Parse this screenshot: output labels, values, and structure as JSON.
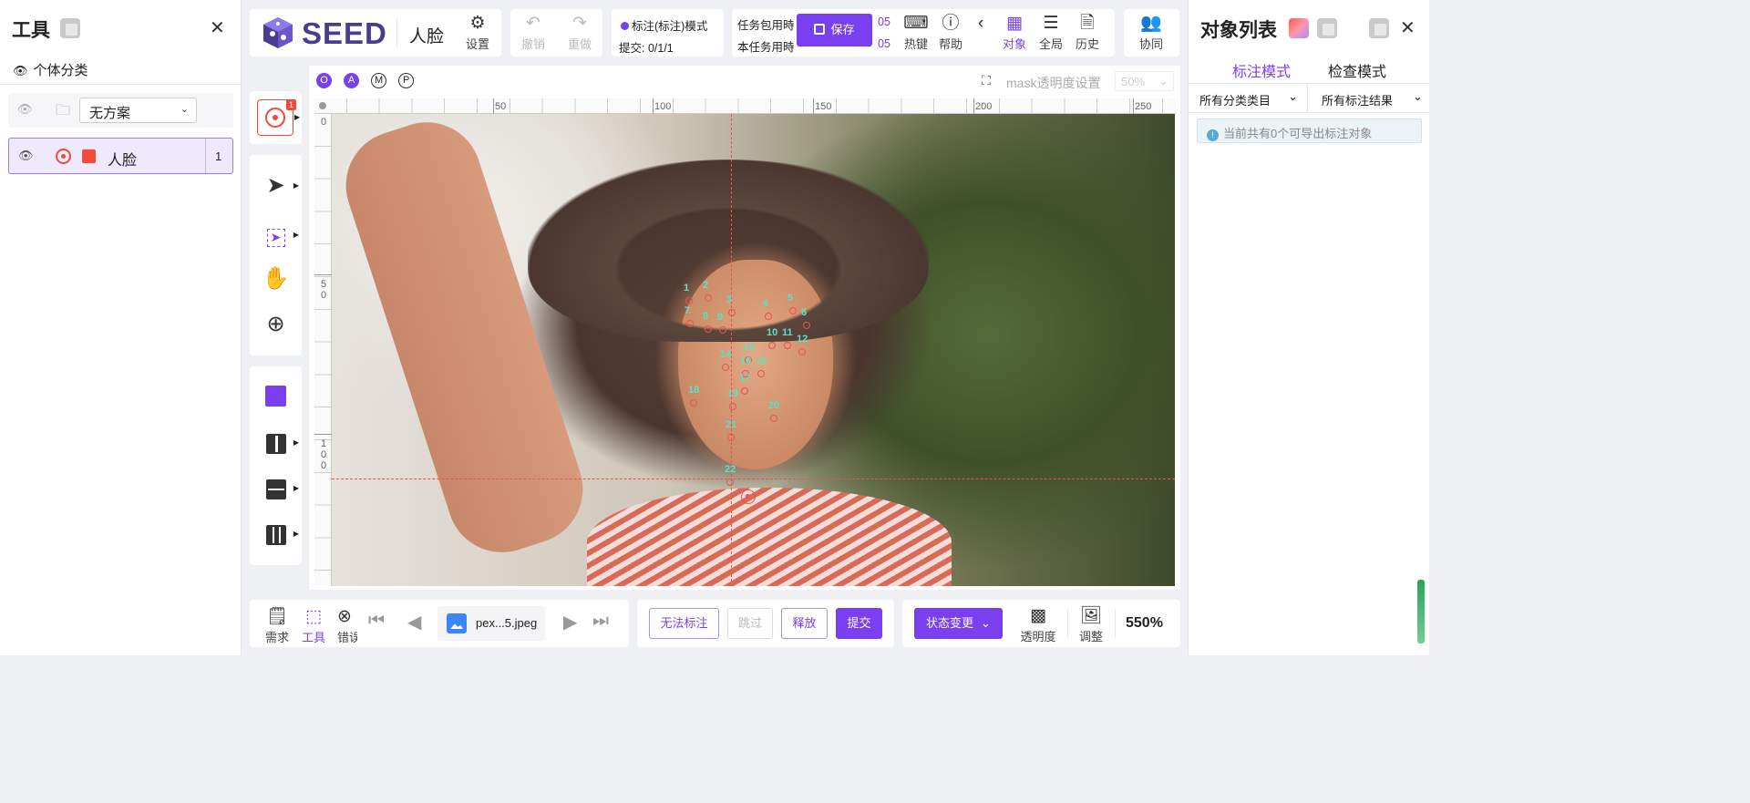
{
  "left_panel": {
    "title": "工具",
    "section_label": "个体分类",
    "scheme_select": "无方案",
    "class_item": {
      "label": "人脸",
      "count": "1",
      "color": "#f04a3a"
    }
  },
  "header": {
    "logo_text": "SEED",
    "project_name": "人脸",
    "settings_label": "设置",
    "undo_label": "撤销",
    "redo_label": "重做",
    "mode_label": "标注(标注)模式",
    "submit_progress": "提交: 0/1/1",
    "task_line1": "任务包用時",
    "task_line2": "本任务用時",
    "task_values": [
      "05",
      "05"
    ],
    "save_label": "保存",
    "hotkey_label": "热键",
    "help_label": "帮助",
    "object_label": "对象",
    "global_label": "全局",
    "history_label": "历史",
    "collab_label": "协同"
  },
  "canvas": {
    "mode_badges": [
      "O",
      "A",
      "M",
      "P"
    ],
    "mask_opacity_label": "mask透明度设置",
    "mask_opacity_value": "50%",
    "ruler_h_ticks": [
      "50",
      "100",
      "150",
      "200",
      "250"
    ],
    "ruler_v_ticks": [
      "0",
      "5\n0",
      "1\n0\n0"
    ],
    "tool_badge": "1",
    "landmarks": [
      "1",
      "2",
      "3",
      "4",
      "5",
      "6",
      "7",
      "8",
      "9",
      "10",
      "11",
      "12",
      "13",
      "14",
      "15",
      "16",
      "17",
      "18",
      "19",
      "20",
      "21",
      "22"
    ]
  },
  "bottom": {
    "tabs": [
      "需求",
      "工具",
      "错误"
    ],
    "file_name": "pex...5.jpeg",
    "cannot_label": "无法标注",
    "skip_label": "跳过",
    "release_label": "释放",
    "submit_label": "提交",
    "status_change_label": "状态变更",
    "opacity_label": "透明度",
    "adjust_label": "调整",
    "zoom": "550%"
  },
  "right_panel": {
    "title": "对象列表",
    "tab_annotate": "标注模式",
    "tab_check": "检查模式",
    "filter_class": "所有分类类目",
    "filter_result": "所有标注结果",
    "info_text": "当前共有0个可导出标注对象"
  },
  "colors": {
    "accent": "#7b3ff2",
    "landmark_text": "#5fe0c3",
    "landmark_dot": "#f05050"
  }
}
